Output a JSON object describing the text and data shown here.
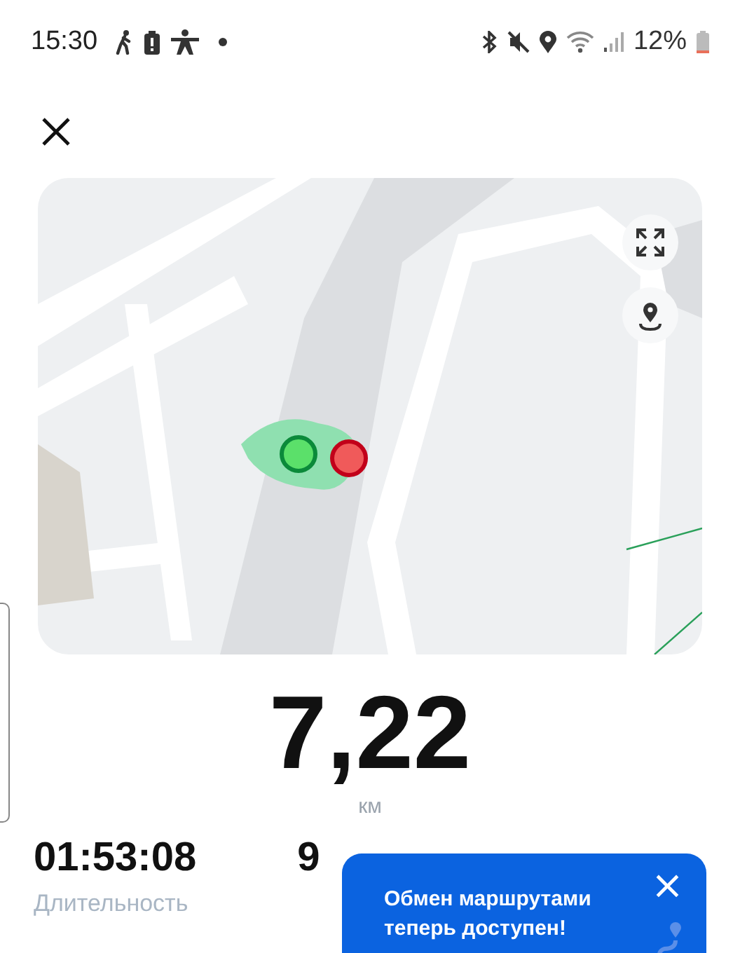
{
  "status_bar": {
    "time": "15:30",
    "battery": "12%"
  },
  "map": {
    "kind": "picture",
    "controls": [
      {
        "kind": "expand"
      },
      {
        "kind": "location"
      }
    ]
  },
  "distance": {
    "value": "7,22",
    "unit": "км"
  },
  "stats": [
    {
      "value": "01:53:08",
      "label": "Длительность"
    },
    {
      "value": "9"
    }
  ],
  "toast": {
    "text": "Обмен маршрутами теперь доступен!",
    "close": "×"
  }
}
